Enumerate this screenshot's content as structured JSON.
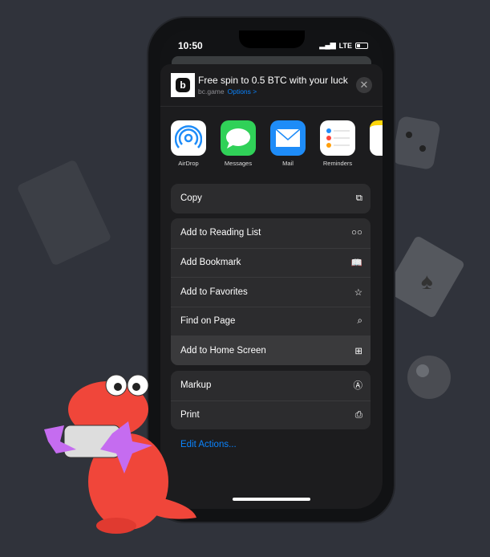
{
  "status": {
    "time": "10:50",
    "network": "LTE"
  },
  "banner": {
    "title": "Free spin to 0.5 BTC with your luck",
    "site": "bc.game",
    "options": "Options >",
    "close": "✕",
    "logo": "b"
  },
  "apps": [
    {
      "label": "AirDrop",
      "icon": "airdrop-icon",
      "color": "#ffffff"
    },
    {
      "label": "Messages",
      "icon": "messages-icon",
      "color": "#30d158"
    },
    {
      "label": "Mail",
      "icon": "mail-icon",
      "color": "#1e8cf8"
    },
    {
      "label": "Reminders",
      "icon": "reminders-icon",
      "color": "#ffffff"
    }
  ],
  "group1": [
    {
      "label": "Copy",
      "icon": "⧉"
    }
  ],
  "group2": [
    {
      "label": "Add to Reading List",
      "icon": "○○"
    },
    {
      "label": "Add Bookmark",
      "icon": "📖"
    },
    {
      "label": "Add to Favorites",
      "icon": "☆"
    },
    {
      "label": "Find on Page",
      "icon": "⌕"
    },
    {
      "label": "Add to Home Screen",
      "icon": "⊞"
    }
  ],
  "group3": [
    {
      "label": "Markup",
      "icon": "Ⓐ"
    },
    {
      "label": "Print",
      "icon": "⎙"
    }
  ],
  "edit_actions": "Edit Actions..."
}
